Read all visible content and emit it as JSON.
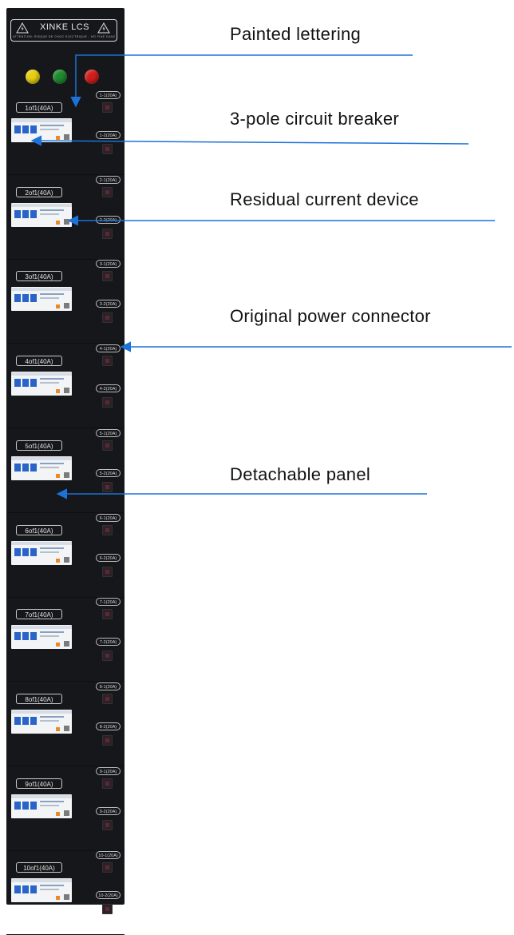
{
  "header": {
    "brand": "XINKE LCS",
    "small_text": "ATTENTION: RISQUE DE CHOC ELECTRIQUE - NO FINE DANGER"
  },
  "lamps": [
    {
      "color": "#e6cf10"
    },
    {
      "color": "#1f8a2e"
    },
    {
      "color": "#d21d1d"
    }
  ],
  "modules": [
    {
      "label": "1of1(40A)",
      "socket_top": "1-1(20A)",
      "socket_bottom": "1-2(20A)"
    },
    {
      "label": "2of1(40A)",
      "socket_top": "2-1(20A)",
      "socket_bottom": "2-2(20A)"
    },
    {
      "label": "3of1(40A)",
      "socket_top": "3-1(20A)",
      "socket_bottom": "3-2(20A)"
    },
    {
      "label": "4of1(40A)",
      "socket_top": "4-1(20A)",
      "socket_bottom": "4-2(20A)"
    },
    {
      "label": "5of1(40A)",
      "socket_top": "5-1(20A)",
      "socket_bottom": "5-2(20A)"
    },
    {
      "label": "6of1(40A)",
      "socket_top": "6-1(20A)",
      "socket_bottom": "6-2(20A)"
    },
    {
      "label": "7of1(40A)",
      "socket_top": "7-1(20A)",
      "socket_bottom": "7-2(20A)"
    },
    {
      "label": "8of1(40A)",
      "socket_top": "8-1(20A)",
      "socket_bottom": "8-2(20A)"
    },
    {
      "label": "9of1(40A)",
      "socket_top": "9-1(20A)",
      "socket_bottom": "9-2(20A)"
    },
    {
      "label": "10of1(40A)",
      "socket_top": "10-1(20A)",
      "socket_bottom": "10-2(20A)"
    }
  ],
  "callouts": [
    {
      "id": "painted-lettering",
      "text": "Painted lettering"
    },
    {
      "id": "three-pole-circuit-breaker",
      "text": "3-pole circuit breaker"
    },
    {
      "id": "residual-current-device",
      "text": "Residual current device"
    },
    {
      "id": "original-power-connector",
      "text": "Original power connector"
    },
    {
      "id": "detachable-panel",
      "text": "Detachable panel"
    }
  ],
  "colors": {
    "panel": "#15171a",
    "arrow": "#1d72d8",
    "breaker_blue": "#2a64c8"
  }
}
